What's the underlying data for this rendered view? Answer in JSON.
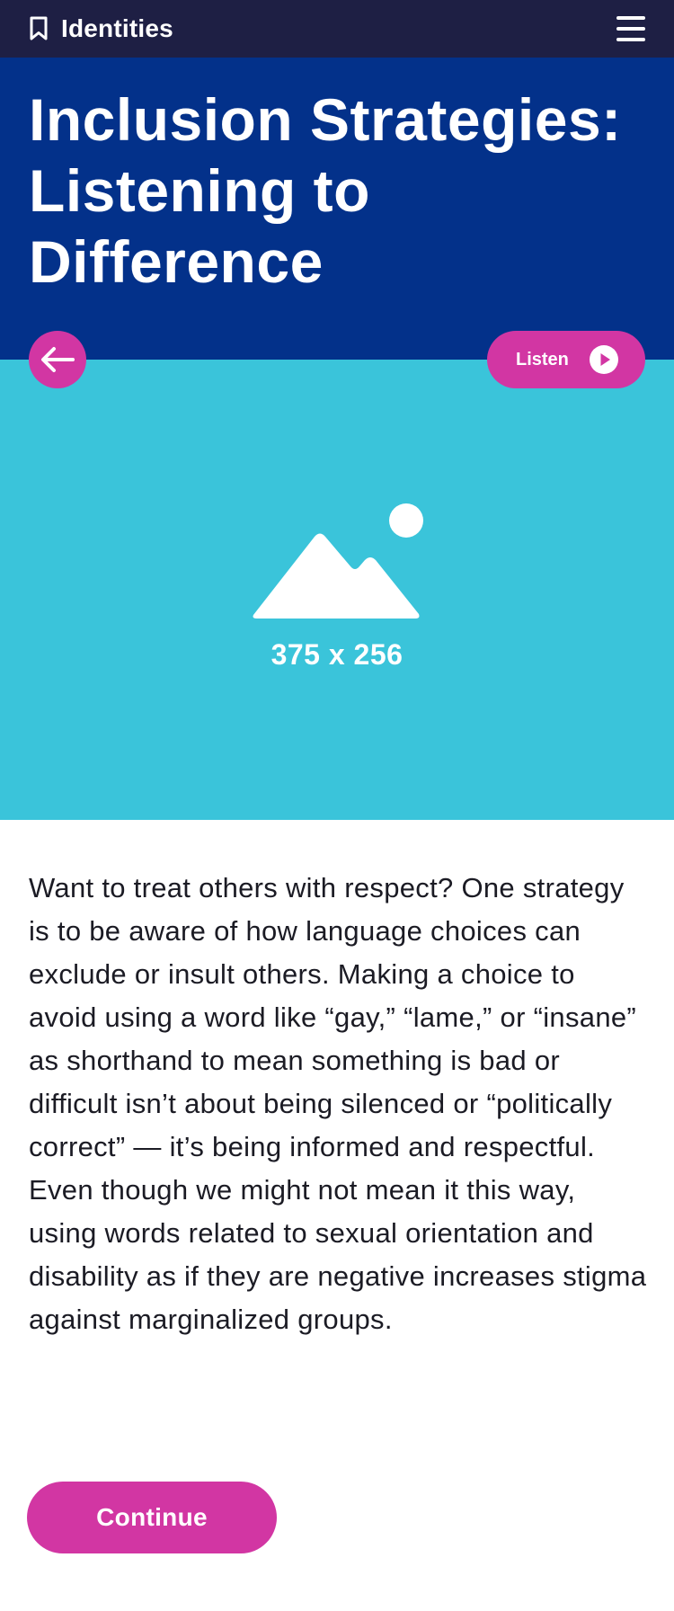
{
  "nav": {
    "brand_label": "Identities",
    "brand_icon": "bookmark-icon",
    "menu_icon": "hamburger-menu-icon"
  },
  "header": {
    "title": "Inclusion Strategies: Listening to Difference"
  },
  "hero": {
    "placeholder_icon": "image-placeholder-icon",
    "placeholder_label": "375 x 256"
  },
  "actions": {
    "back_icon": "arrow-left-icon",
    "listen_label": "Listen",
    "listen_icon": "play-icon",
    "continue_label": "Continue"
  },
  "content": {
    "paragraph": "Want to treat others with respect? One strategy is to be aware of how language choices can exclude or insult others. Making a choice to avoid using a word like “gay,” “lame,” or “insane” as shorthand to mean something is bad or difficult isn’t about being silenced or “politically correct” — it’s being informed and respectful. Even though we might not mean it this way, using words related to sexual orientation and disability as if they are negative increases stigma against marginalized groups."
  },
  "colors": {
    "nav_bg": "#1e1f44",
    "title_bg": "#03318a",
    "hero_bg": "#3ac4da",
    "accent": "#d236a3",
    "text": "#1b1b24"
  }
}
